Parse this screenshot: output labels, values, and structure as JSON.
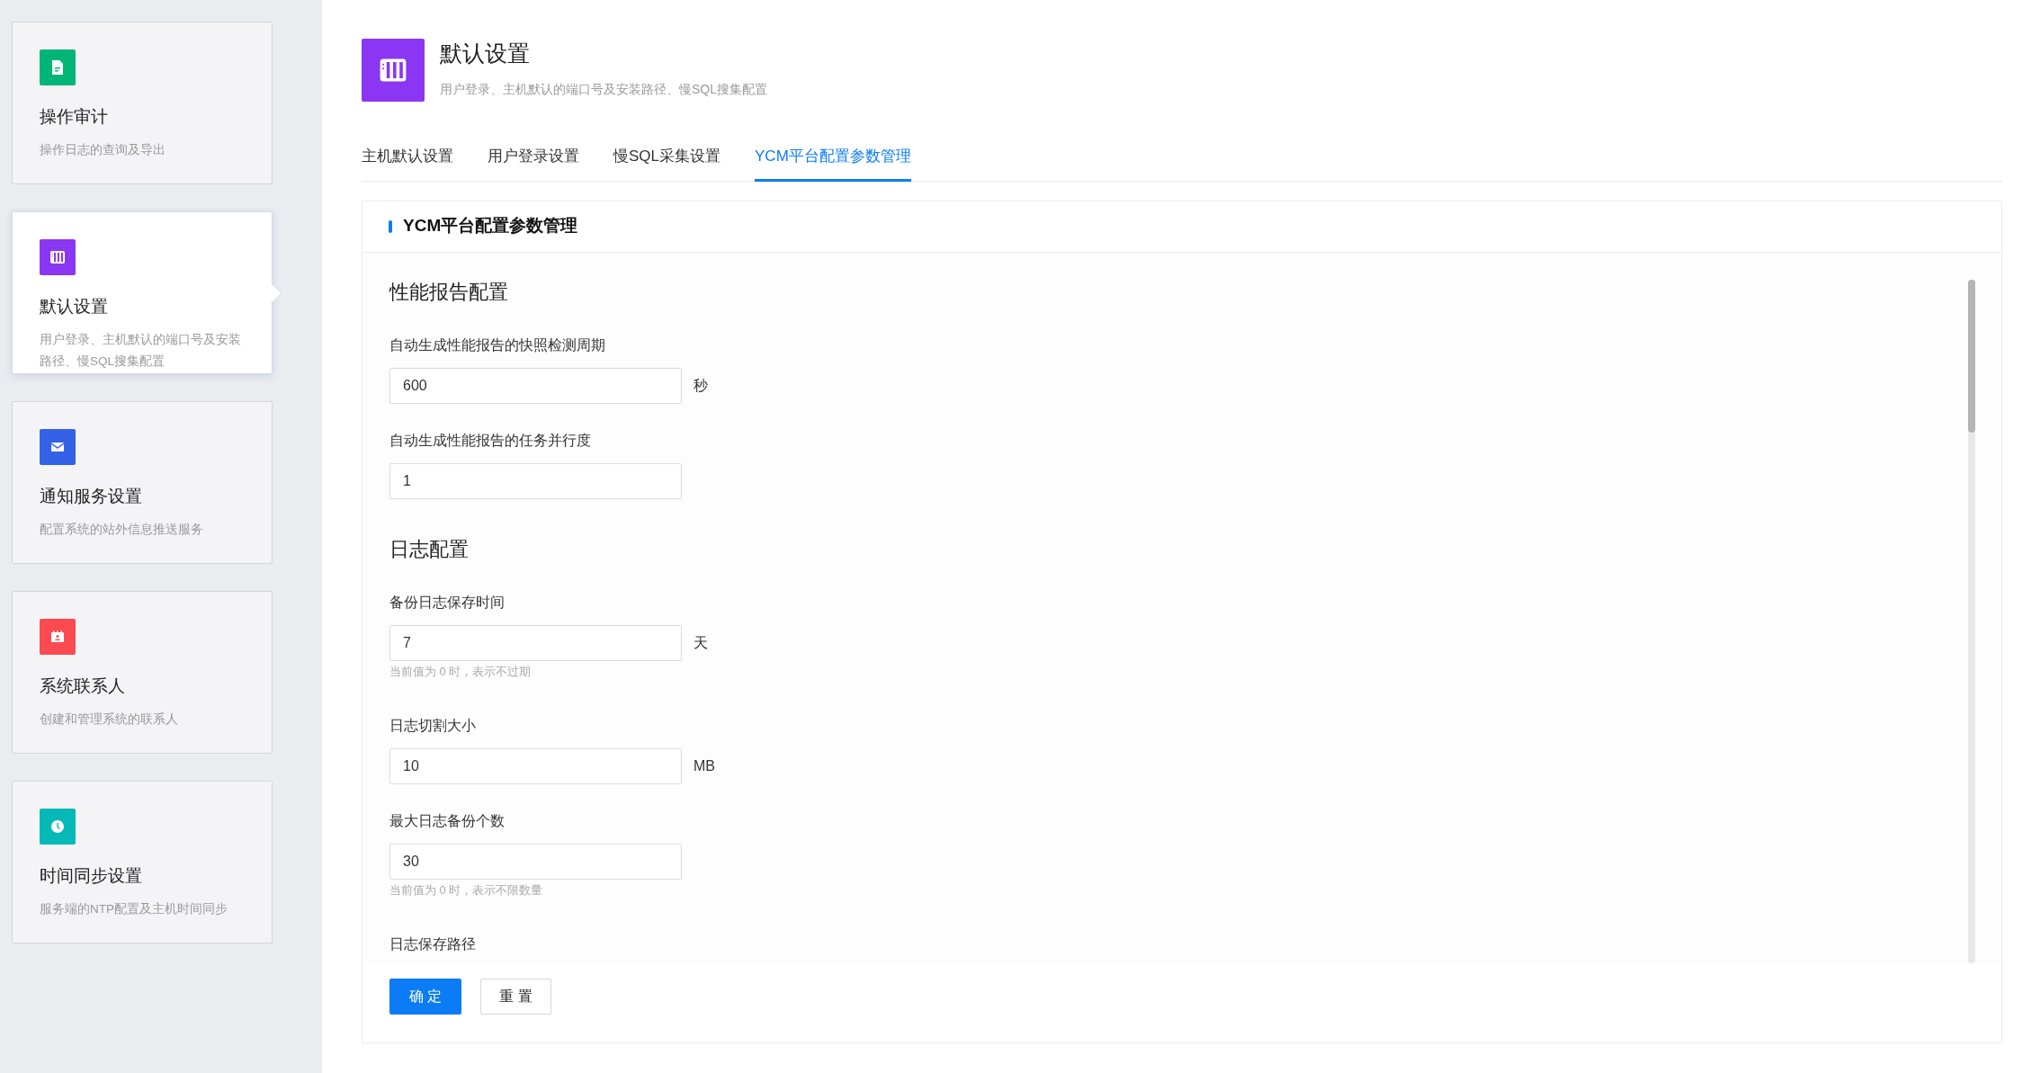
{
  "sidebar": {
    "items": [
      {
        "title": "操作审计",
        "description": "操作日志的查询及导出",
        "color": "#00b576",
        "selected": false
      },
      {
        "title": "默认设置",
        "description": "用户登录、主机默认的端口号及安装路径、慢SQL搜集配置",
        "color": "#8b36f2",
        "selected": true
      },
      {
        "title": "通知服务设置",
        "description": "配置系统的站外信息推送服务",
        "color": "#3462e6",
        "selected": false
      },
      {
        "title": "系统联系人",
        "description": "创建和管理系统的联系人",
        "color": "#fb4b51",
        "selected": false
      },
      {
        "title": "时间同步设置",
        "description": "服务端的NTP配置及主机时间同步",
        "color": "#06b8b8",
        "selected": false
      }
    ]
  },
  "header": {
    "title": "默认设置",
    "subtitle": "用户登录、主机默认的端口号及安装路径、慢SQL搜集配置"
  },
  "tabs": [
    {
      "label": "主机默认设置",
      "selected": false
    },
    {
      "label": "用户登录设置",
      "selected": false
    },
    {
      "label": "慢SQL采集设置",
      "selected": false
    },
    {
      "label": "YCM平台配置参数管理",
      "selected": true
    }
  ],
  "panel": {
    "title": "YCM平台配置参数管理",
    "sections": [
      {
        "title": "性能报告配置",
        "fields": [
          {
            "label": "自动生成性能报告的快照检测周期",
            "value": "600",
            "unit": "秒"
          },
          {
            "label": "自动生成性能报告的任务并行度",
            "value": "1"
          }
        ]
      },
      {
        "title": "日志配置",
        "fields": [
          {
            "label": "备份日志保存时间",
            "value": "7",
            "unit": "天",
            "hint": "当前值为 0 时，表示不过期"
          },
          {
            "label": "日志切割大小",
            "value": "10",
            "unit": "MB"
          },
          {
            "label": "最大日志备份个数",
            "value": "30",
            "hint": "当前值为 0 时，表示不限数量"
          },
          {
            "label": "日志保存路径"
          }
        ]
      }
    ]
  },
  "buttons": [
    {
      "label": "确 定",
      "kind": "primary"
    },
    {
      "label": "重 置",
      "kind": "default"
    }
  ]
}
